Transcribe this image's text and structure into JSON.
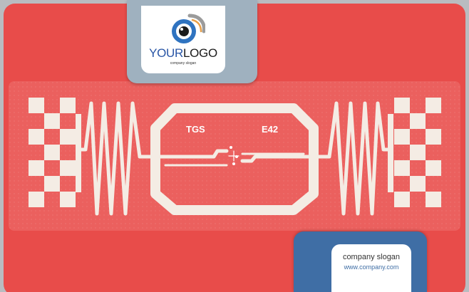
{
  "logo": {
    "brand_part1": "YOUR",
    "brand_part2": "LOGO",
    "slogan": "company slogan"
  },
  "tag": {
    "label_left": "TGS",
    "label_right": "E42"
  },
  "contact": {
    "slogan": "company slogan",
    "website": "www.company.com"
  },
  "colors": {
    "card_red": "#e84c4a",
    "logo_tab": "#9fb1bf",
    "contact_tab": "#3f6ea5",
    "antenna": "#f4ece4"
  }
}
